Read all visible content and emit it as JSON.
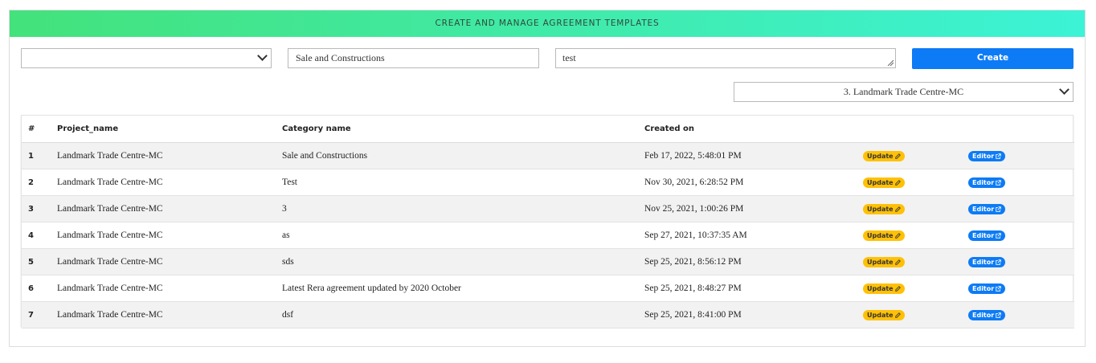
{
  "header": {
    "title": "CREATE AND MANAGE AGREEMENT TEMPLATES"
  },
  "form": {
    "left_select_value": "",
    "category_value": "Sale and Constructions",
    "name_value": "test",
    "create_label": "Create",
    "project_select_value": "3. Landmark Trade Centre-MC"
  },
  "table": {
    "headers": {
      "num": "#",
      "project": "Project_name",
      "category": "Category name",
      "created": "Created on"
    },
    "update_label": "Update",
    "editor_label": "Editor",
    "rows": [
      {
        "num": "1",
        "project": "Landmark Trade Centre-MC",
        "category": "Sale and Constructions",
        "created": "Feb 17, 2022, 5:48:01 PM"
      },
      {
        "num": "2",
        "project": "Landmark Trade Centre-MC",
        "category": "Test",
        "created": "Nov 30, 2021, 6:28:52 PM"
      },
      {
        "num": "3",
        "project": "Landmark Trade Centre-MC",
        "category": "3",
        "created": "Nov 25, 2021, 1:00:26 PM"
      },
      {
        "num": "4",
        "project": "Landmark Trade Centre-MC",
        "category": "as",
        "created": "Sep 27, 2021, 10:37:35 AM"
      },
      {
        "num": "5",
        "project": "Landmark Trade Centre-MC",
        "category": "sds",
        "created": "Sep 25, 2021, 8:56:12 PM"
      },
      {
        "num": "6",
        "project": "Landmark Trade Centre-MC",
        "category": "Latest Rera agreement updated by 2020 October",
        "created": "Sep 25, 2021, 8:48:27 PM"
      },
      {
        "num": "7",
        "project": "Landmark Trade Centre-MC",
        "category": "dsf",
        "created": "Sep 25, 2021, 8:41:00 PM"
      }
    ]
  },
  "colors": {
    "accent": "#0d7bf5",
    "update_badge": "#ffc107",
    "header_gradient_start": "#43e27b",
    "header_gradient_end": "#3cf3d6"
  },
  "icons": {
    "update": "edit-icon",
    "editor": "external-link-icon",
    "select": "chevron-down-icon"
  }
}
